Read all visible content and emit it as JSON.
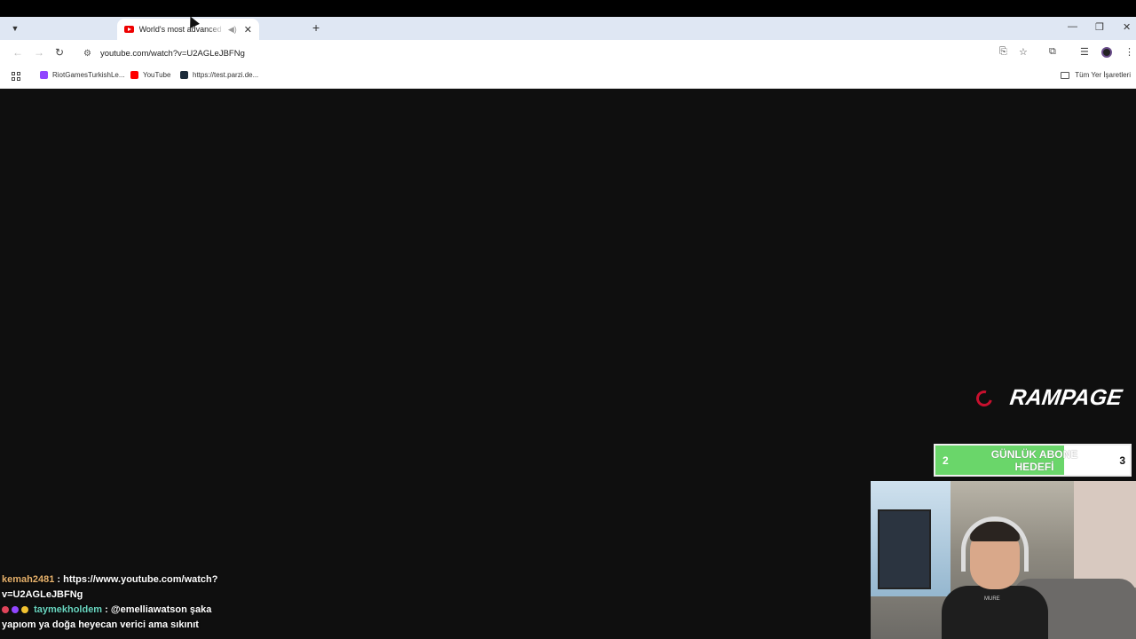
{
  "browser": {
    "tab": {
      "title": "World's most advanced rob",
      "close": "✕"
    },
    "new_tab": "+",
    "window_controls": {
      "minimize": "—",
      "restore": "❐",
      "close": "✕"
    },
    "nav": {
      "back": "←",
      "forward": "→",
      "reload": "↻"
    },
    "omnibox": {
      "site_info": "⚙",
      "url": "youtube.com/watch?v=U2AGLeJBFNg"
    },
    "toolbar_icons": {
      "install": "⎘",
      "bookmark_star": "☆",
      "extensions": "⧉",
      "media": "☰",
      "menu": "⋮"
    },
    "bookmarks": [
      {
        "label": "RiotGamesTurkishLe...",
        "color": "#9146ff"
      },
      {
        "label": "YouTube",
        "color": "#ff0000"
      },
      {
        "label": "https://test.parzi.de...",
        "color": "#1b2a3a"
      }
    ],
    "all_bookmarks": "Tüm Yer İşaretleri"
  },
  "overlay": {
    "brand": "RAMPAGE",
    "subscriber_goal": {
      "current": "2",
      "target": "3",
      "label": "GÜNLÜK ABONE HEDEFİ",
      "progress": 0.66,
      "fill_color": "#6ad66a"
    },
    "webcam_shirt": "MURE"
  },
  "chat": [
    {
      "user": "kemah2481",
      "message": ": https://www.youtube.com/watch?v=U2AGLeJBFNg"
    },
    {
      "user": "taymekholdem",
      "message": ": @emelliawatson şaka yapıom ya doğa heyecan verici ama sıkınıt"
    }
  ]
}
